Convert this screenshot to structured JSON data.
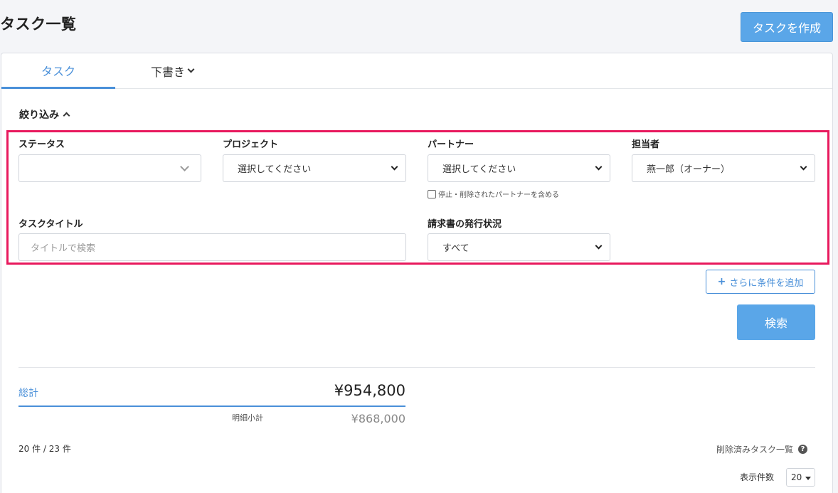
{
  "page": {
    "title": "タスク一覧",
    "create_button": "タスクを作成"
  },
  "tabs": [
    {
      "label": "タスク",
      "active": true
    },
    {
      "label": "下書き"
    }
  ],
  "filter": {
    "heading": "絞り込み",
    "status": {
      "label": "ステータス",
      "value": ""
    },
    "project": {
      "label": "プロジェクト",
      "value": "選択してください"
    },
    "partner": {
      "label": "パートナー",
      "value": "選択してください",
      "checkbox_label": "停止・削除されたパートナーを含める",
      "checkbox_checked": false
    },
    "assignee": {
      "label": "担当者",
      "value": "燕一郎（オーナー）"
    },
    "task_title": {
      "label": "タスクタイトル",
      "placeholder": "タイトルで検索"
    },
    "invoice_status": {
      "label": "請求書の発行状況",
      "value": "すべて"
    },
    "add_condition": "さらに条件を追加",
    "search_button": "検索"
  },
  "summary": {
    "total_label": "総計",
    "total_value": "¥954,800",
    "subtotal_label": "明細小計",
    "subtotal_value": "¥868,000"
  },
  "results": {
    "count": "20 件 / 23 件",
    "deleted_link": "削除済みタスク一覧",
    "per_page_label": "表示件数",
    "per_page_value": "20"
  },
  "colors": {
    "accent": "#4a90d9",
    "primary_button": "#5aa6e8",
    "highlight": "#e8195d"
  }
}
